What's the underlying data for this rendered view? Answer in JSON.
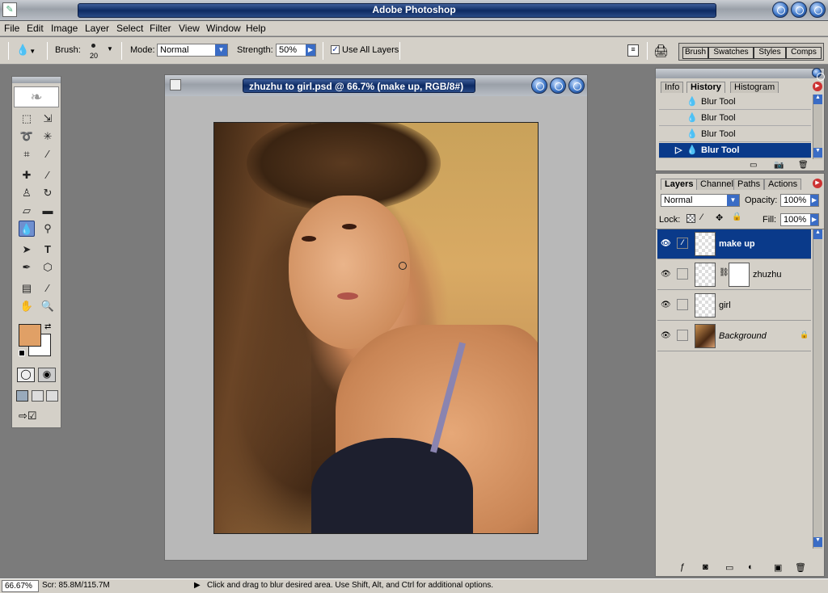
{
  "app": {
    "title": "Adobe Photoshop"
  },
  "menu": [
    "File",
    "Edit",
    "Image",
    "Layer",
    "Select",
    "Filter",
    "View",
    "Window",
    "Help"
  ],
  "options": {
    "brush_label": "Brush:",
    "brush_size": "20",
    "mode_label": "Mode:",
    "mode_value": "Normal",
    "strength_label": "Strength:",
    "strength_value": "50%",
    "use_all_layers_label": "Use All Layers",
    "use_all_layers_checked": true,
    "palette_tabs": [
      "Brush",
      "Swatches",
      "Styles",
      "Comps"
    ]
  },
  "toolbox": {
    "foreground_color": "#e0a066",
    "background_color": "#ffffff"
  },
  "document": {
    "title": "zhuzhu to girl.psd @ 66.7% (make up, RGB/8#)"
  },
  "history_panel": {
    "tabs": [
      "Info",
      "History",
      "Histogram"
    ],
    "active_tab": "History",
    "items": [
      {
        "label": "Blur Tool",
        "selected": false
      },
      {
        "label": "Blur Tool",
        "selected": false
      },
      {
        "label": "Blur Tool",
        "selected": false
      },
      {
        "label": "Blur Tool",
        "selected": true
      }
    ]
  },
  "layers_panel": {
    "tabs": [
      "Layers",
      "Channels",
      "Paths",
      "Actions"
    ],
    "active_tab": "Layers",
    "blend_mode": "Normal",
    "opacity_label": "Opacity:",
    "opacity_value": "100%",
    "lock_label": "Lock:",
    "fill_label": "Fill:",
    "fill_value": "100%",
    "layers": [
      {
        "name": "make up",
        "selected": true
      },
      {
        "name": "zhuzhu",
        "selected": false
      },
      {
        "name": "girl",
        "selected": false
      },
      {
        "name": "Background",
        "selected": false
      }
    ]
  },
  "status": {
    "zoom": "66.67%",
    "scratch": "Scr: 85.8M/115.7M",
    "hint": "Click and drag to blur desired area.  Use Shift, Alt, and Ctrl for additional options."
  }
}
